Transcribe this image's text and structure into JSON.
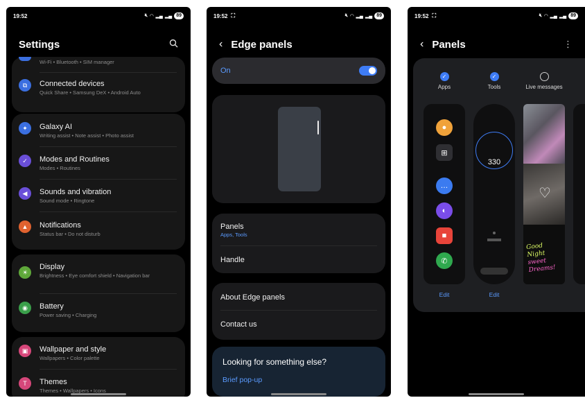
{
  "status": {
    "time": "19:52",
    "battery": "89"
  },
  "settings": {
    "title": "Settings",
    "partial_subtitle": "Wi-Fi • Bluetooth • SIM manager",
    "items": [
      {
        "title": "Connected devices",
        "subtitle": "Quick Share • Samsung DeX • Android Auto",
        "icon": "link-icon",
        "color": "#3b6fe0"
      },
      {
        "title": "Galaxy AI",
        "subtitle": "Writing assist • Note assist • Photo assist",
        "icon": "sparkle-icon",
        "color": "#3b6fe0"
      },
      {
        "title": "Modes and Routines",
        "subtitle": "Modes • Routines",
        "icon": "check-circle-icon",
        "color": "#6a4fd8"
      },
      {
        "title": "Sounds and vibration",
        "subtitle": "Sound mode • Ringtone",
        "icon": "speaker-icon",
        "color": "#6a4fd8"
      },
      {
        "title": "Notifications",
        "subtitle": "Status bar • Do not disturb",
        "icon": "bell-icon",
        "color": "#e0622f"
      },
      {
        "title": "Display",
        "subtitle": "Brightness • Eye comfort shield • Navigation bar",
        "icon": "sun-icon",
        "color": "#5fa83a"
      },
      {
        "title": "Battery",
        "subtitle": "Power saving • Charging",
        "icon": "battery-icon",
        "color": "#3a9f4a"
      },
      {
        "title": "Wallpaper and style",
        "subtitle": "Wallpapers • Color palette",
        "icon": "image-icon",
        "color": "#d6477a"
      },
      {
        "title": "Themes",
        "subtitle": "Themes • Wallpapers • Icons",
        "icon": "theme-icon",
        "color": "#d6477a"
      }
    ]
  },
  "edge": {
    "title": "Edge panels",
    "on_label": "On",
    "panels_title": "Panels",
    "panels_sub": "Apps, Tools",
    "handle": "Handle",
    "about": "About Edge panels",
    "contact": "Contact us",
    "looking": "Looking for something else?",
    "brief": "Brief pop-up"
  },
  "panels": {
    "title": "Panels",
    "options": [
      {
        "label": "Apps",
        "checked": true
      },
      {
        "label": "Tools",
        "checked": true
      },
      {
        "label": "Live messages",
        "checked": false
      }
    ],
    "compass_value": "330",
    "edit": "Edit",
    "live_text": [
      "Good",
      "Night",
      "sweet",
      "Dreams!"
    ]
  }
}
